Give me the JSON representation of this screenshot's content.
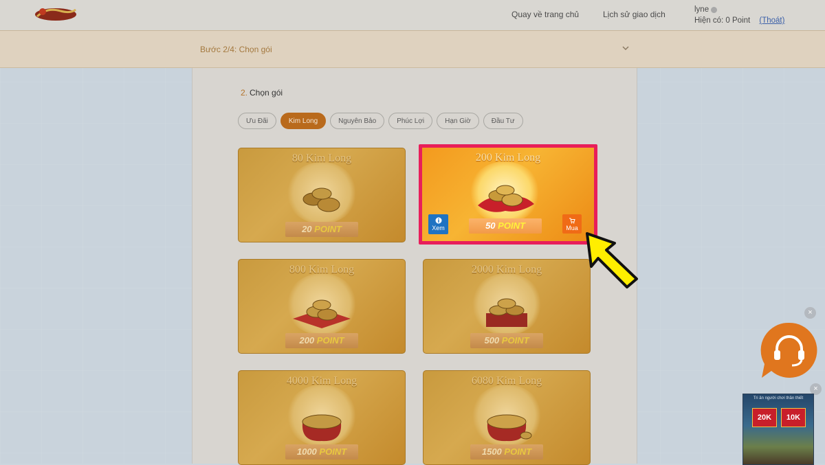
{
  "header": {
    "nav": [
      {
        "label": "Quay về trang chủ"
      },
      {
        "label": "Lịch sử giao dịch"
      }
    ],
    "user": {
      "name": "lyne",
      "balance": "Hiện có: 0 Point",
      "logout": "(Thoát)"
    }
  },
  "step": {
    "label": "Bước 2/4: Chọn gói"
  },
  "section": {
    "number": "2.",
    "title": "Chọn gói"
  },
  "tabs": [
    {
      "label": "Ưu Đãi"
    },
    {
      "label": "Kim Long"
    },
    {
      "label": "Nguyên Bảo"
    },
    {
      "label": "Phúc Lợi"
    },
    {
      "label": "Hạn Giờ"
    },
    {
      "label": "Đầu Tư"
    }
  ],
  "packages": [
    {
      "title": "80 Kim Long",
      "amount": "20",
      "unit": "POINT"
    },
    {
      "title": "200 Kim Long",
      "amount": "50",
      "unit": "POINT"
    },
    {
      "title": "800 Kim Long",
      "amount": "200",
      "unit": "POINT"
    },
    {
      "title": "2000 Kim Long",
      "amount": "500",
      "unit": "POINT"
    },
    {
      "title": "4000 Kim Long",
      "amount": "1000",
      "unit": "POINT"
    },
    {
      "title": "6080 Kim Long",
      "amount": "1500",
      "unit": "POINT"
    }
  ],
  "card_actions": {
    "view": "Xem",
    "buy": "Mua"
  },
  "promo": {
    "title": "Tri ân người chơi thân thiết",
    "badge1": "20K",
    "badge2": "10K"
  },
  "colors": {
    "accent": "#b96a1c",
    "highlight_border": "#e81e5a",
    "arrow": "#ffee00"
  }
}
